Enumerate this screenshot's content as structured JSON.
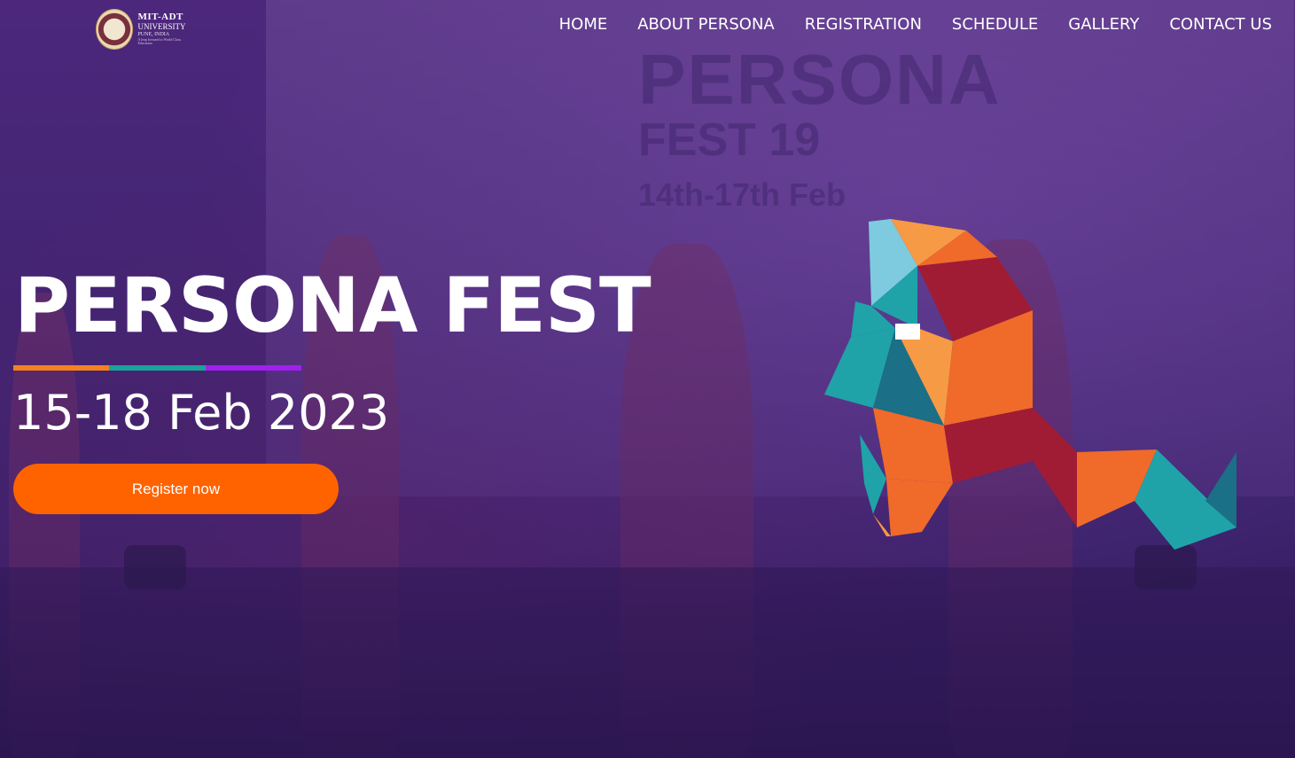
{
  "logo": {
    "line1": "MIT-ADT",
    "line2": "UNIVERSITY",
    "line3": "PUNE, INDIA",
    "line4": "A leap forward to World Class Education"
  },
  "nav": {
    "items": [
      {
        "label": "HOME"
      },
      {
        "label": "ABOUT PERSONA"
      },
      {
        "label": "REGISTRATION"
      },
      {
        "label": "SCHEDULE"
      },
      {
        "label": "GALLERY"
      },
      {
        "label": "CONTACT US"
      }
    ]
  },
  "background_banner": {
    "line1": "PERSONA",
    "line2": "FEST 19",
    "line3": "14th-17th Feb"
  },
  "hero": {
    "title": "PERSONA FEST",
    "date": "15-18 Feb 2023",
    "cta_label": "Register now",
    "rule_colors": [
      "#f5821f",
      "#1aa39a",
      "#a020f0"
    ]
  },
  "colors": {
    "accent": "#ff6300",
    "overlay": "#4a2a78"
  }
}
